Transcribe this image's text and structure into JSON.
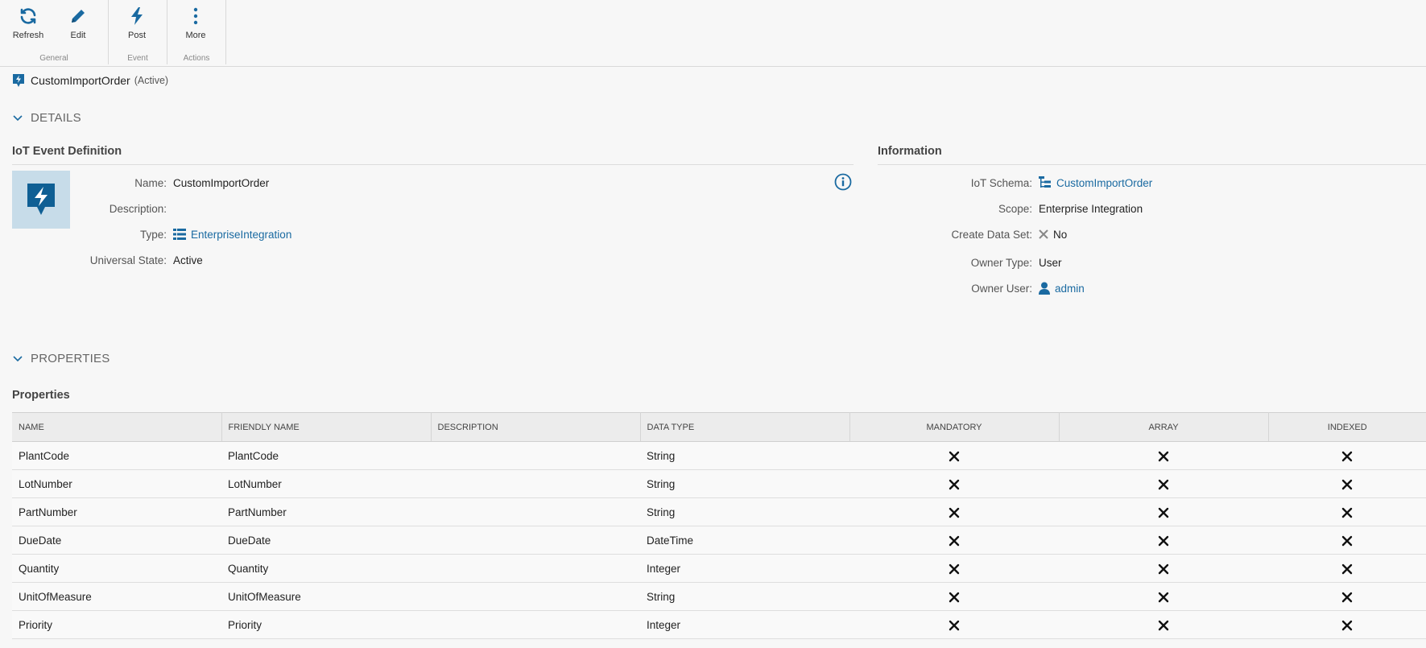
{
  "toolbar": {
    "groups": [
      {
        "label": "General",
        "buttons": [
          {
            "label": "Refresh",
            "icon": "refresh-icon"
          },
          {
            "label": "Edit",
            "icon": "pencil-icon"
          }
        ]
      },
      {
        "label": "Event",
        "buttons": [
          {
            "label": "Post",
            "icon": "lightning-icon"
          }
        ]
      },
      {
        "label": "Actions",
        "buttons": [
          {
            "label": "More",
            "icon": "more-vertical-icon"
          }
        ]
      }
    ]
  },
  "title": {
    "name": "CustomImportOrder",
    "state": "(Active)"
  },
  "details": {
    "section_label": "DETAILS",
    "left": {
      "heading": "IoT Event Definition",
      "name_label": "Name:",
      "name_value": "CustomImportOrder",
      "description_label": "Description:",
      "description_value": "",
      "type_label": "Type:",
      "type_value": "EnterpriseIntegration",
      "state_label": "Universal State:",
      "state_value": "Active"
    },
    "right": {
      "heading": "Information",
      "schema_label": "IoT Schema:",
      "schema_value": "CustomImportOrder",
      "scope_label": "Scope:",
      "scope_value": "Enterprise Integration",
      "dataset_label": "Create Data Set:",
      "dataset_value": "No",
      "owner_type_label": "Owner Type:",
      "owner_type_value": "User",
      "owner_user_label": "Owner User:",
      "owner_user_value": "admin"
    }
  },
  "properties": {
    "section_label": "PROPERTIES",
    "heading": "Properties",
    "columns": [
      "NAME",
      "FRIENDLY NAME",
      "DESCRIPTION",
      "DATA TYPE",
      "MANDATORY",
      "ARRAY",
      "INDEXED"
    ],
    "rows": [
      {
        "name": "PlantCode",
        "friendly": "PlantCode",
        "description": "",
        "type": "String",
        "mandatory": false,
        "array": false,
        "indexed": false
      },
      {
        "name": "LotNumber",
        "friendly": "LotNumber",
        "description": "",
        "type": "String",
        "mandatory": false,
        "array": false,
        "indexed": false
      },
      {
        "name": "PartNumber",
        "friendly": "PartNumber",
        "description": "",
        "type": "String",
        "mandatory": false,
        "array": false,
        "indexed": false
      },
      {
        "name": "DueDate",
        "friendly": "DueDate",
        "description": "",
        "type": "DateTime",
        "mandatory": false,
        "array": false,
        "indexed": false
      },
      {
        "name": "Quantity",
        "friendly": "Quantity",
        "description": "",
        "type": "Integer",
        "mandatory": false,
        "array": false,
        "indexed": false
      },
      {
        "name": "UnitOfMeasure",
        "friendly": "UnitOfMeasure",
        "description": "",
        "type": "String",
        "mandatory": false,
        "array": false,
        "indexed": false
      },
      {
        "name": "Priority",
        "friendly": "Priority",
        "description": "",
        "type": "Integer",
        "mandatory": false,
        "array": false,
        "indexed": false
      }
    ]
  },
  "colors": {
    "accent": "#1a6aa1",
    "icon_bg": "#c7dce9"
  }
}
